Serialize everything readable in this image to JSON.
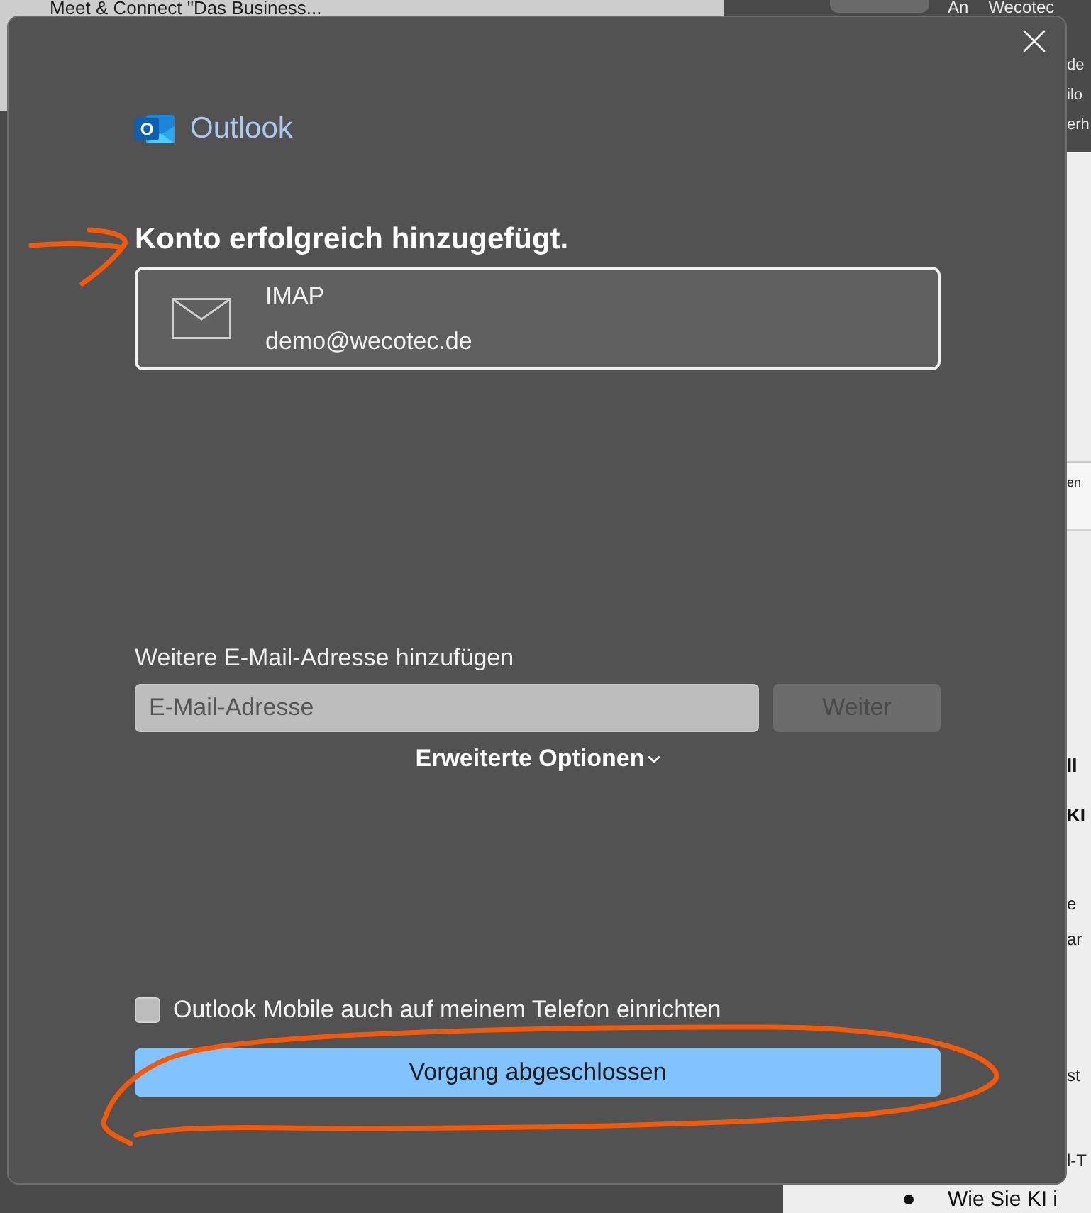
{
  "background": {
    "top_left_text": "Meet & Connect \"Das Business...",
    "top_right_label": "An",
    "top_right_value": "Wecotec",
    "side_texts_top": [
      "de",
      "ilo",
      "erh"
    ],
    "side_tab_label": "en",
    "side_texts": [
      {
        "text": "ll",
        "kind": "heading"
      },
      {
        "text": "KI",
        "kind": "heading"
      },
      {
        "text": "e",
        "kind": "text"
      },
      {
        "text": "ar",
        "kind": "text"
      },
      {
        "text": "st",
        "kind": "text"
      },
      {
        "text": "l-T",
        "kind": "text"
      }
    ],
    "list_item": "Wie Sie KI i"
  },
  "dialog": {
    "app": {
      "logo_letter": "O",
      "name": "Outlook"
    },
    "heading": "Konto erfolgreich hinzugefügt.",
    "account": {
      "type": "IMAP",
      "email": "demo@wecotec.de"
    },
    "add_label": "Weitere E-Mail-Adresse hinzufügen",
    "email_field": {
      "placeholder": "E-Mail-Adresse"
    },
    "next_button": {
      "label": "Weiter",
      "disabled": true
    },
    "advanced_options": {
      "label": "Erweiterte Optionen",
      "expanded": false
    },
    "mobile_checkbox": {
      "label": "Outlook Mobile auch auf meinem Telefon einrichten",
      "checked": false
    },
    "done_button": "Vorgang abgeschlossen"
  },
  "annotations": [
    {
      "kind": "arrow"
    },
    {
      "kind": "ellipse"
    }
  ]
}
